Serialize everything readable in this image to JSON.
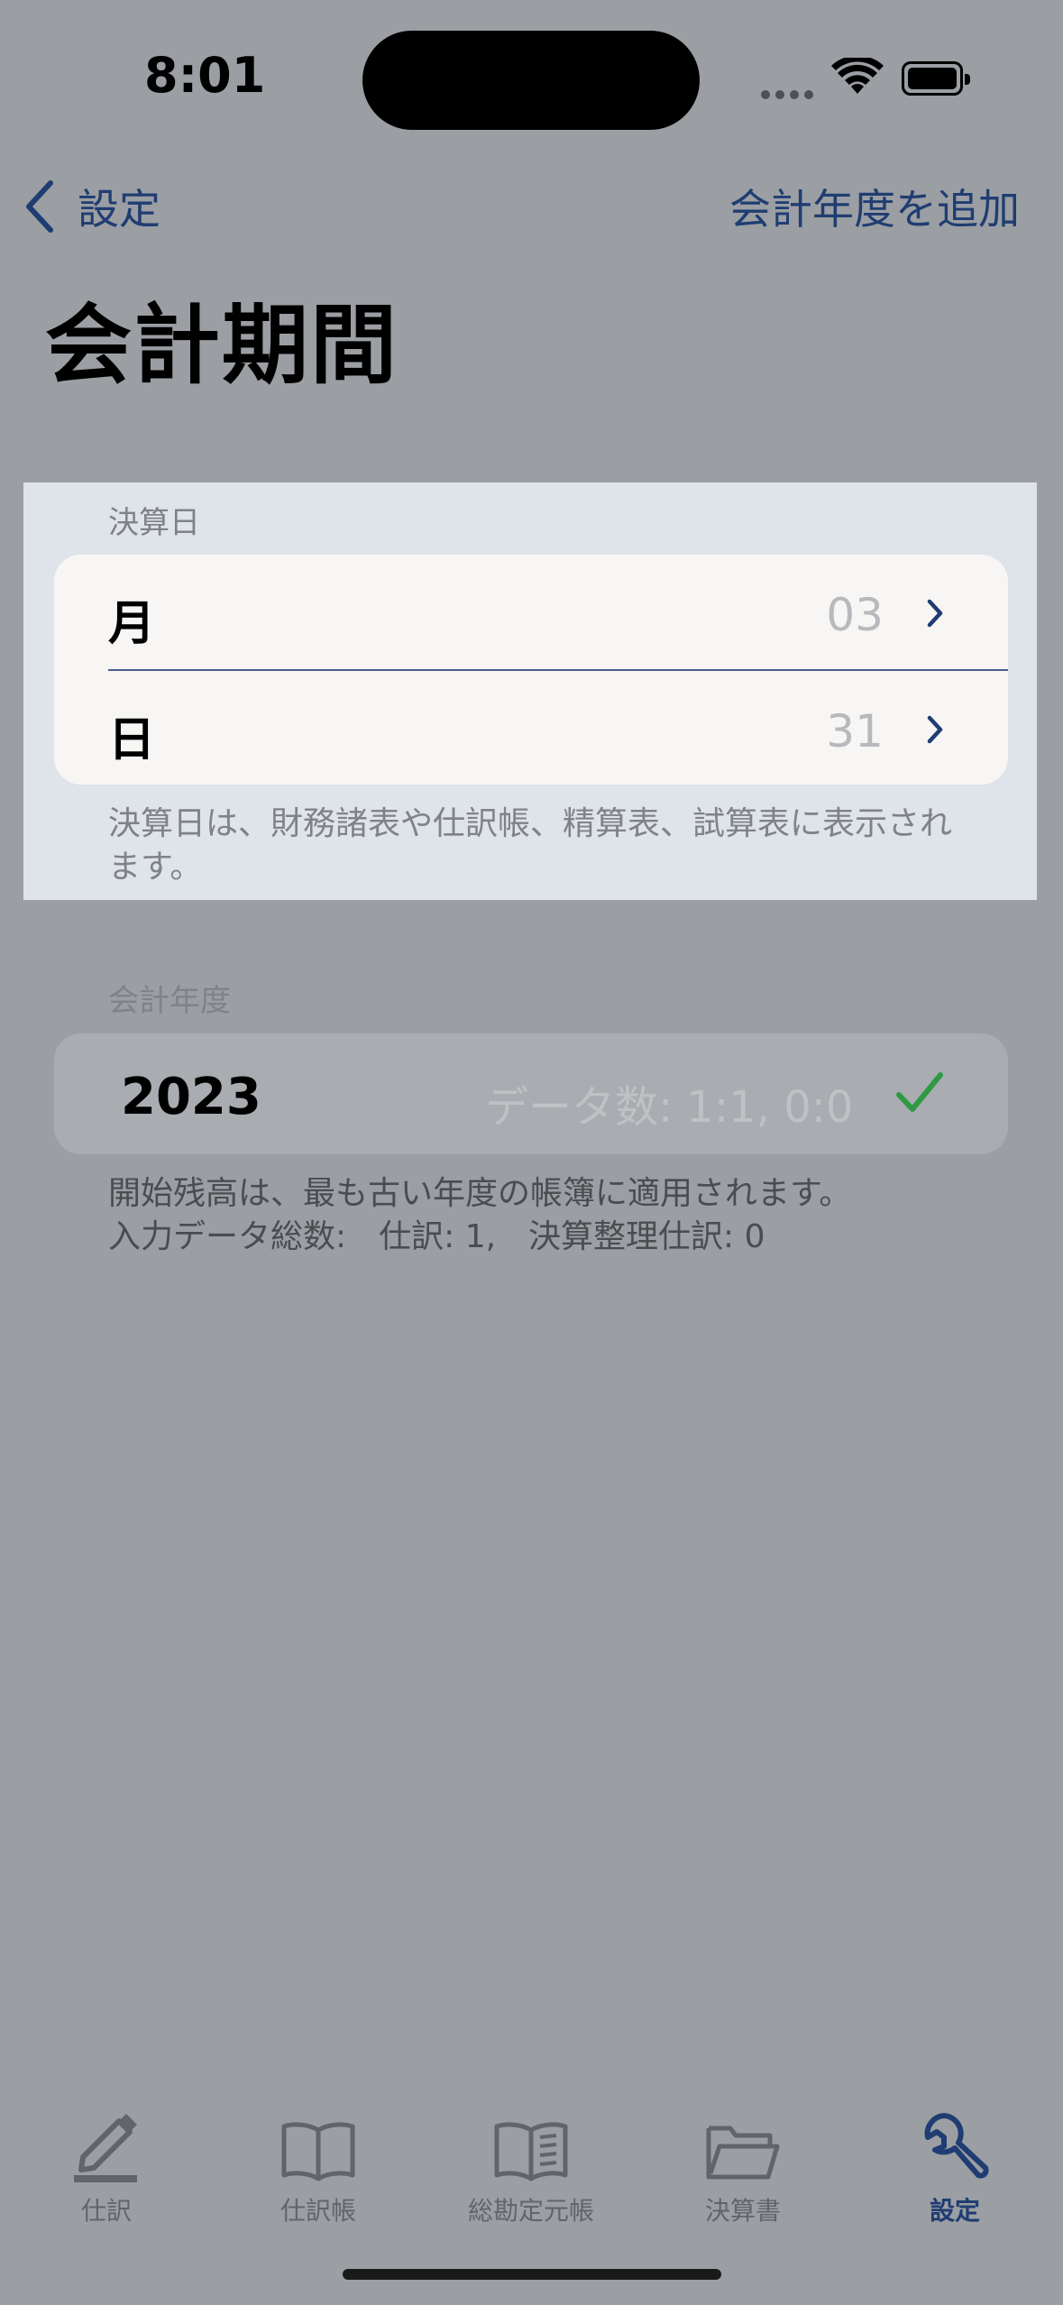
{
  "status_bar": {
    "time": "8:01"
  },
  "nav": {
    "back_label": "設定",
    "add_label": "会計年度を追加"
  },
  "page_title": "会計期間",
  "closing_date": {
    "header": "決算日",
    "rows": [
      {
        "label": "月",
        "value": "03"
      },
      {
        "label": "日",
        "value": "31"
      }
    ],
    "footer": "決算日は、財務諸表や仕訳帳、精算表、試算表に表示されます。"
  },
  "fiscal_year": {
    "header": "会計年度",
    "year": "2023",
    "data_count": "データ数: 1:1,  0:0",
    "footer_line1": "開始残高は、最も古い年度の帳簿に適用されます。",
    "footer_line2": "入力データ総数:　仕訳: 1,　決算整理仕訳: 0"
  },
  "tabs": [
    {
      "label": "仕訳",
      "icon": "pencil-icon"
    },
    {
      "label": "仕訳帳",
      "icon": "book-icon"
    },
    {
      "label": "総勘定元帳",
      "icon": "book-lines-icon"
    },
    {
      "label": "決算書",
      "icon": "folder-icon"
    },
    {
      "label": "設定",
      "icon": "wrench-icon",
      "active": true
    }
  ],
  "colors": {
    "accent": "#1f3d72",
    "check": "#2e9a44",
    "background": "#9b9ea3"
  }
}
